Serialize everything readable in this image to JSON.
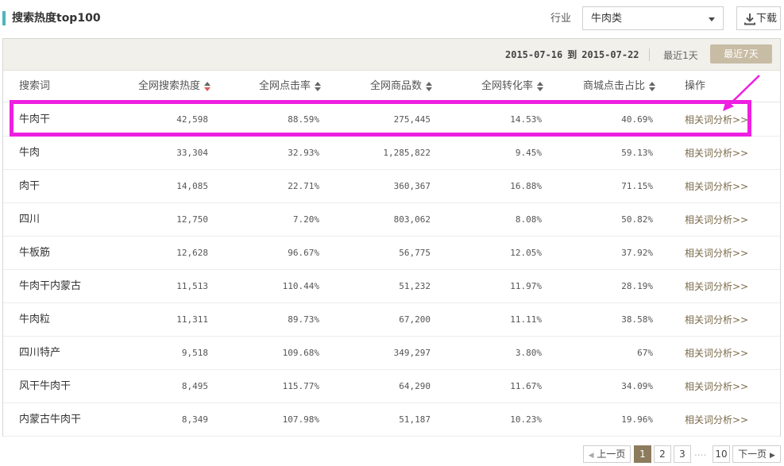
{
  "header": {
    "title": "搜索热度top100",
    "industry_label": "行业",
    "industry_value": "牛肉类",
    "download_label": "下载"
  },
  "filter": {
    "date_start": "2015-07-16",
    "date_to": "到",
    "date_end": "2015-07-22",
    "btn_1day": "最近1天",
    "btn_7day": "最近7天"
  },
  "table": {
    "columns": [
      "搜索词",
      "全网搜索热度",
      "全网点击率",
      "全网商品数",
      "全网转化率",
      "商城点击占比",
      "操作"
    ],
    "rows": [
      {
        "kw": "牛肉干",
        "heat": "42,598",
        "ctr": "88.59%",
        "items": "275,445",
        "cvr": "14.53%",
        "mall": "40.69%",
        "op": "相关词分析>>"
      },
      {
        "kw": "牛肉",
        "heat": "33,304",
        "ctr": "32.93%",
        "items": "1,285,822",
        "cvr": "9.45%",
        "mall": "59.13%",
        "op": "相关词分析>>"
      },
      {
        "kw": "肉干",
        "heat": "14,085",
        "ctr": "22.71%",
        "items": "360,367",
        "cvr": "16.88%",
        "mall": "71.15%",
        "op": "相关词分析>>"
      },
      {
        "kw": "四川",
        "heat": "12,750",
        "ctr": "7.20%",
        "items": "803,062",
        "cvr": "8.08%",
        "mall": "50.82%",
        "op": "相关词分析>>"
      },
      {
        "kw": "牛板筋",
        "heat": "12,628",
        "ctr": "96.67%",
        "items": "56,775",
        "cvr": "12.05%",
        "mall": "37.92%",
        "op": "相关词分析>>"
      },
      {
        "kw": "牛肉干内蒙古",
        "heat": "11,513",
        "ctr": "110.44%",
        "items": "51,232",
        "cvr": "11.97%",
        "mall": "28.19%",
        "op": "相关词分析>>"
      },
      {
        "kw": "牛肉粒",
        "heat": "11,311",
        "ctr": "89.73%",
        "items": "67,200",
        "cvr": "11.11%",
        "mall": "38.58%",
        "op": "相关词分析>>"
      },
      {
        "kw": "四川特产",
        "heat": "9,518",
        "ctr": "109.68%",
        "items": "349,297",
        "cvr": "3.80%",
        "mall": "67%",
        "op": "相关词分析>>"
      },
      {
        "kw": "风干牛肉干",
        "heat": "8,495",
        "ctr": "115.77%",
        "items": "64,290",
        "cvr": "11.67%",
        "mall": "34.09%",
        "op": "相关词分析>>"
      },
      {
        "kw": "内蒙古牛肉干",
        "heat": "8,349",
        "ctr": "107.98%",
        "items": "51,187",
        "cvr": "10.23%",
        "mall": "19.96%",
        "op": "相关词分析>>"
      }
    ]
  },
  "pager": {
    "prev": "上一页",
    "pages": [
      "1",
      "2",
      "3"
    ],
    "dots": "....",
    "last": "10",
    "next": "下一页",
    "current": "1"
  },
  "colors": {
    "accent": "#4fb5bf",
    "highlight": "#ee1fe0",
    "active_tab": "#c8bca5",
    "current_page": "#8c7b5c"
  }
}
